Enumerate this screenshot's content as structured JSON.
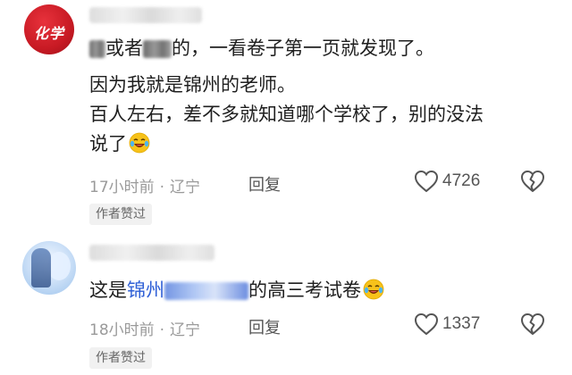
{
  "comments": [
    {
      "avatar_label": "化学",
      "text_line1_prefix": "",
      "text_line1_mid": "或者",
      "text_line1_suffix": "的，一看卷子第一页就发现了。",
      "text_line2": "因为我就是锦州的老师。",
      "text_line3": "百人左右，差不多就知道哪个学校了，别的没法",
      "text_line4": "说了",
      "time": "17小时前",
      "separator": "·",
      "location": "辽宁",
      "reply_label": "回复",
      "like_count": "4726",
      "author_badge": "作者赞过",
      "emoji": "laugh-cry-emoji"
    },
    {
      "text_prefix": "这是",
      "text_link": "锦州",
      "text_suffix": "的高三考试卷",
      "time": "18小时前",
      "separator": "·",
      "location": "辽宁",
      "reply_label": "回复",
      "like_count": "1337",
      "author_badge": "作者赞过",
      "emoji": "laugh-cry-emoji"
    }
  ],
  "colors": {
    "link": "#2e5fd6",
    "meta": "#9a9a9a",
    "text": "#1f1f1f",
    "avatar_red": "#c81a24"
  }
}
